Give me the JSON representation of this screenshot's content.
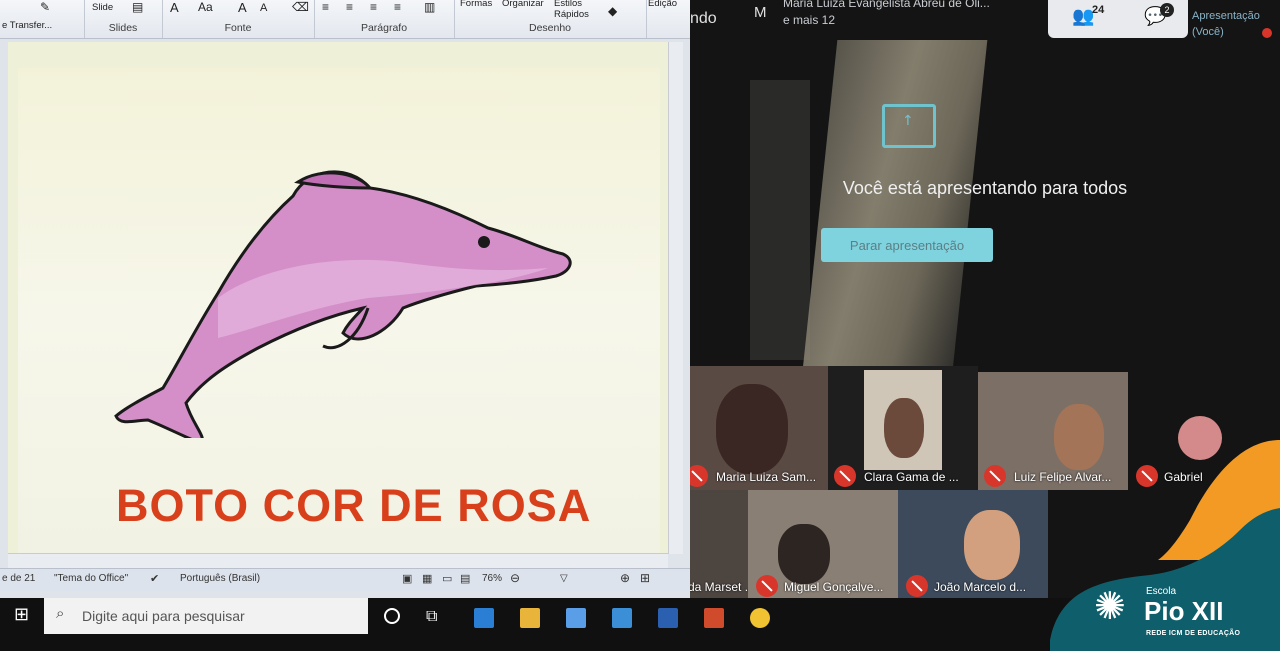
{
  "ribbon": {
    "clipboard_item": "e Transfer...",
    "slide_item": "Slide",
    "groups": [
      "Slides",
      "Fonte",
      "Parágrafo",
      "Desenho",
      "Edição"
    ],
    "drawing_items": [
      "Formas",
      "Organizar",
      "Estilos Rápidos"
    ],
    "font_glyphs": [
      "A",
      "Aa",
      "A",
      "A"
    ]
  },
  "slide": {
    "title": "BOTO COR DE ROSA",
    "image": "pink-dolphin"
  },
  "statusbar": {
    "page": "e de 21",
    "theme": "\"Tema do Office\"",
    "language": "Português (Brasil)",
    "zoom": "76%"
  },
  "meet": {
    "partial_title": "ndo",
    "avatar_letter": "M",
    "participants_line1": "Maria Luiza Evangelista Abreu de Oli...",
    "participants_line2": "e mais 12",
    "people_count": "24",
    "chat_count": "2",
    "presenter_label_1": "Apresentação",
    "presenter_label_2": "(Você)",
    "presenting_message": "Você está apresentando para todos",
    "stop_button": "Parar apresentação",
    "tiles": [
      {
        "name": "Maria Luiza Sam..."
      },
      {
        "name": "Clara Gama de ..."
      },
      {
        "name": "Luiz Felipe Alvar..."
      },
      {
        "name": "Gabriel"
      },
      {
        "name": "da Marset ..."
      },
      {
        "name": "Miguel Gonçalve..."
      },
      {
        "name": "João Marcelo d..."
      }
    ]
  },
  "taskbar": {
    "search_placeholder": "Digite aqui para pesquisar"
  },
  "logo": {
    "school_label": "Escola",
    "name": "Pio XII",
    "network": "REDE ICM DE EDUCAÇÃO"
  },
  "colors": {
    "slide_title": "#d8401c",
    "dolphin": "#d48fc9",
    "meet_accent": "#7fd3df",
    "mic_off": "#d9362b",
    "logo_teal": "#0e5f6b",
    "logo_orange": "#f29a24"
  }
}
